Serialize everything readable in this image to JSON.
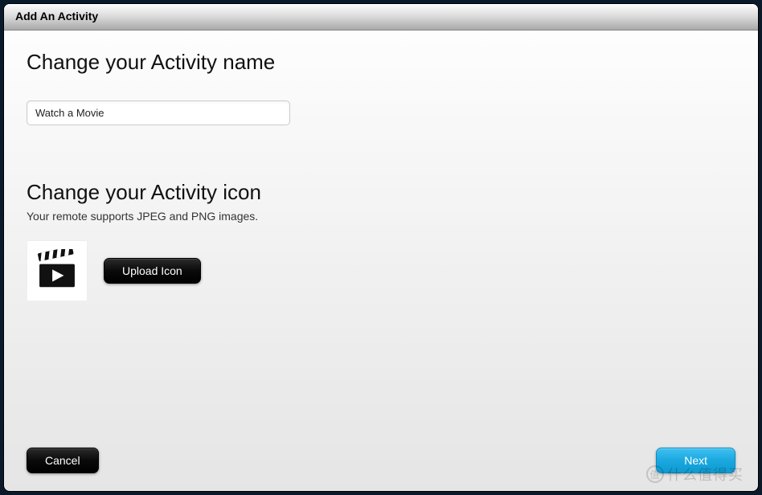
{
  "dialog": {
    "title": "Add An Activity"
  },
  "sections": {
    "name": {
      "heading": "Change your Activity name",
      "input_value": "Watch a Movie"
    },
    "icon": {
      "heading": "Change your Activity icon",
      "subtext": "Your remote supports JPEG and PNG images.",
      "upload_label": "Upload Icon",
      "preview_name": "movie-clapperboard-icon"
    }
  },
  "footer": {
    "cancel_label": "Cancel",
    "next_label": "Next"
  },
  "watermark": {
    "logo_text": "值",
    "text": "什么值得买"
  }
}
